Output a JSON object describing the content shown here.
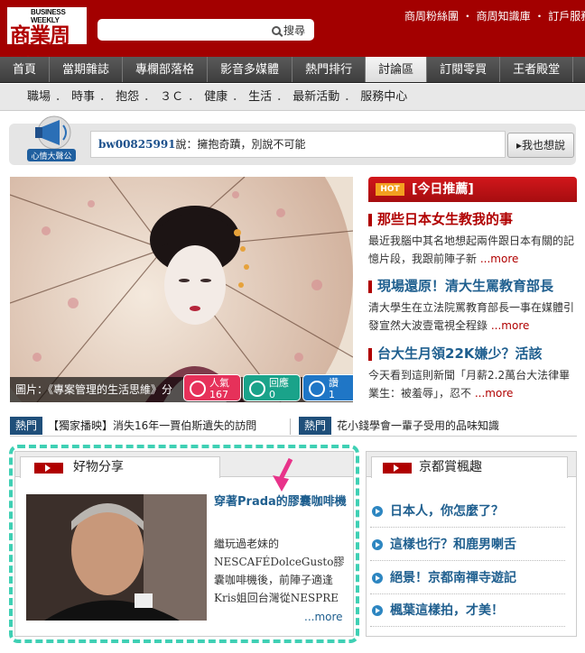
{
  "header": {
    "logo_small": "BUSINESS WEEKLY",
    "logo_big": "商業周刊",
    "search_label": "搜尋",
    "top_links": "商周粉絲團 ・ 商周知識庫 ・ 訂戶服務"
  },
  "nav": {
    "items": [
      "首頁",
      "當期雜誌",
      "專欄部落格",
      "影音多媒體",
      "熱門排行",
      "討論區",
      "訂閱零買",
      "王者殿堂"
    ],
    "active_index": 5
  },
  "subnav": {
    "items": [
      "職場",
      "時事",
      "抱怨",
      "３Ｃ",
      "健康",
      "生活",
      "最新活動",
      "服務中心"
    ]
  },
  "mood": {
    "icon_label": "心情大聲公",
    "user": "bw00825991",
    "said": "說：",
    "message": "擁抱奇蹟，別說不可能",
    "button": "我也想說"
  },
  "hero": {
    "caption": "圖片：《專案管理的生活思維》分",
    "badges": [
      {
        "label": "人氣",
        "count": "167"
      },
      {
        "label": "回應",
        "count": "0"
      },
      {
        "label": "讚",
        "count": "1"
      }
    ]
  },
  "recommend": {
    "hot_tag": "HOT",
    "title": "[今日推薦]",
    "items": [
      {
        "title": "那些日本女生教我的事",
        "desc": "最近我腦中其名地想起兩件跟日本有關的記憶片段，我跟前陣子新",
        "more": "...more"
      },
      {
        "title": "現場還原！清大生罵教育部長",
        "desc": "清大學生在立法院罵教育部長一事在媒體引發宣然大波壹電視全程錄",
        "more": "...more"
      },
      {
        "title": "台大生月領22K嫌少？活該",
        "desc": "今天看到這則新聞「月薪2.2萬台大法律畢業生：被羞辱」，忍不",
        "more": "...more"
      }
    ]
  },
  "hotbar": {
    "tag": "熱門",
    "left": "【獨家播映】消失16年一賈伯斯遺失的訪問",
    "right": "花小錢學會一輩子受用的品味知識"
  },
  "goods": {
    "tab": "好物分享",
    "title": "穿著Prada的膠囊咖啡機",
    "desc": "繼玩過老妹的NESCAFÉDolceGusto膠囊咖啡機後，前陣子適逢Kris姐回台灣從NESPRE",
    "more": "...more"
  },
  "kyoto": {
    "tab": "京都賞楓趣",
    "items": [
      "日本人，你怎麼了？",
      "這樣也行？和鹿男喇舌",
      "絕景！京都南禪寺遊記",
      "楓葉這樣拍，才美！"
    ]
  },
  "colors": {
    "brand_red": "#a30000",
    "link_blue": "#1f5f8f",
    "dash_teal": "#3fd0b4"
  }
}
